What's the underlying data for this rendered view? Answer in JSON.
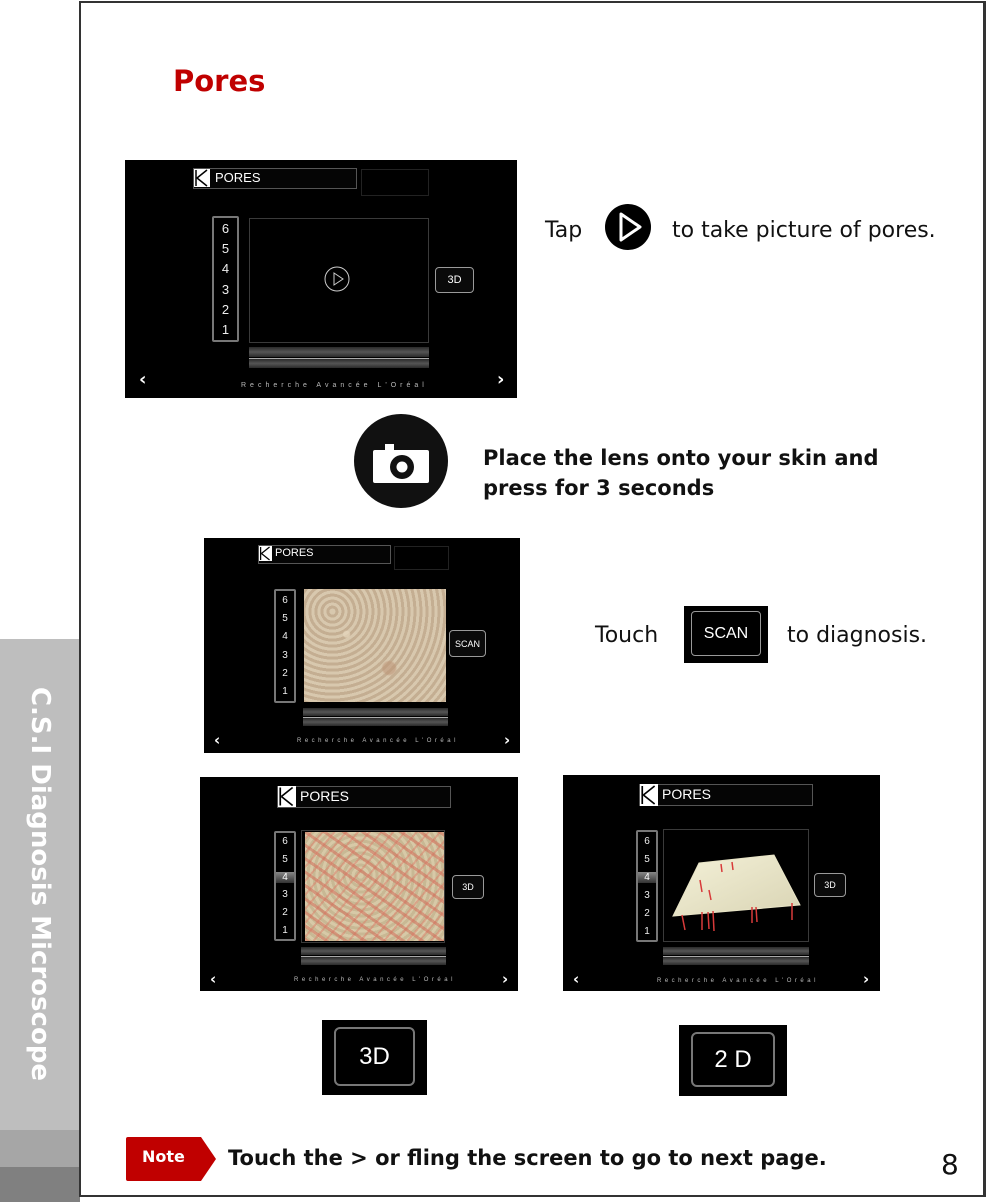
{
  "sidebar": {
    "tab_label": "C.S.I Diagnosis Microscope",
    "colors": {
      "tab": "#bebebe",
      "band1": "#a6a6a6",
      "band2": "#808080"
    }
  },
  "page": {
    "title": "Pores",
    "title_color": "#c00000",
    "page_number": "8"
  },
  "device": {
    "header_title": "PORES",
    "scale_levels": [
      "6",
      "5",
      "4",
      "3",
      "2",
      "1"
    ],
    "footer_text": "Recherche Avancée L'Oréal",
    "nav_prev": "‹",
    "nav_next": "›"
  },
  "screens": [
    {
      "name": "capture-screen",
      "view": "empty-with-play",
      "button_label": "3D",
      "selected_level": null
    },
    {
      "name": "scan-screen",
      "view": "skin-image",
      "button_label": "SCAN",
      "selected_level": null
    },
    {
      "name": "result-2d-screen",
      "view": "pore-map-2d",
      "button_label": "3D",
      "selected_level": "4"
    },
    {
      "name": "result-3d-screen",
      "view": "pore-map-3d",
      "button_label": "3D",
      "selected_level": "4"
    }
  ],
  "steps": {
    "step1": {
      "prefix": "Tap",
      "icon": "play-icon",
      "suffix": "to take picture of pores."
    },
    "step2": {
      "icon": "camera-icon",
      "line1": "Place the lens onto your skin and",
      "line2": "press for 3 seconds"
    },
    "step3": {
      "prefix": "Touch",
      "button_label": "SCAN",
      "suffix": "to diagnosis."
    },
    "toggle_3d_label": "3D",
    "toggle_2d_label": "2 D"
  },
  "note": {
    "badge": "Note",
    "badge_color": "#c00000",
    "message": "Touch the  > or fling the screen to go to next  page."
  }
}
